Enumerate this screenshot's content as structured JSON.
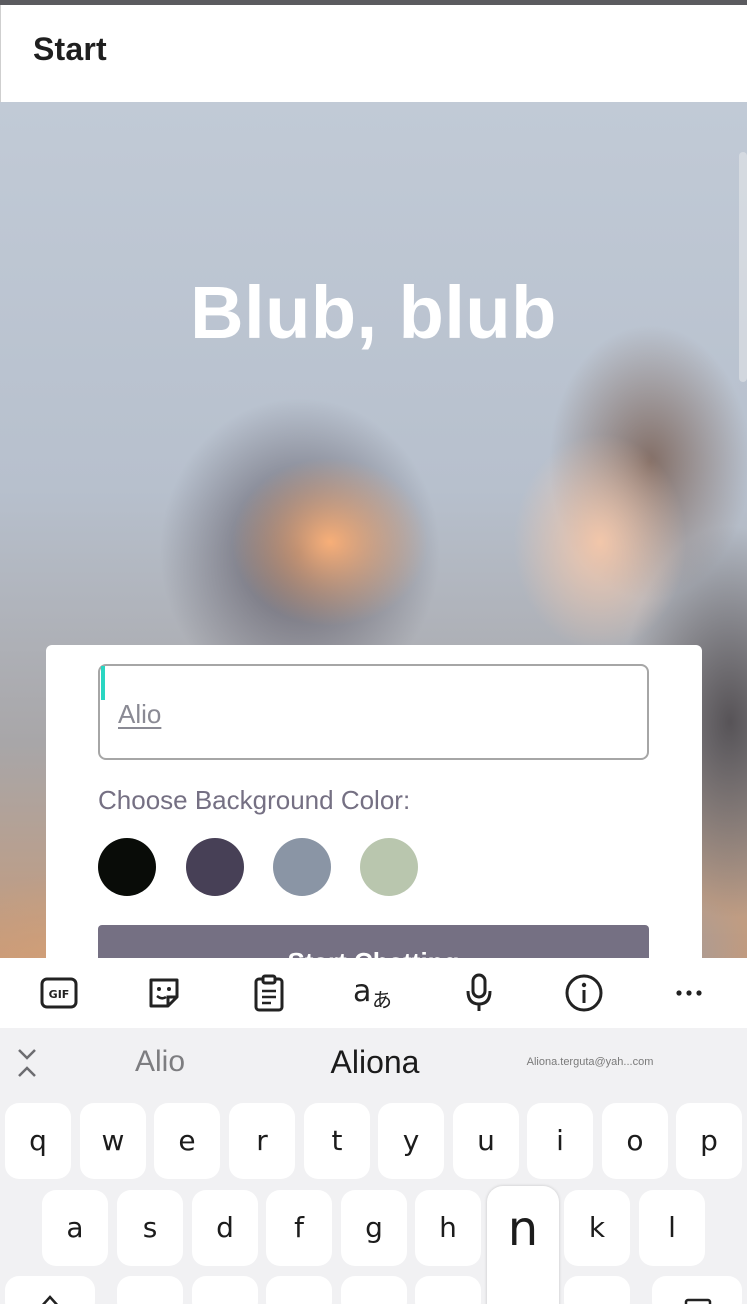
{
  "app_bar": {
    "title": "Start"
  },
  "hero": {
    "title": "Blub, blub"
  },
  "form": {
    "name_value": "Alio",
    "bg_label": "Choose Background Color:",
    "colors": [
      "#090C08",
      "#474056",
      "#8A95A5",
      "#B9C6AE"
    ],
    "button_label": "Start Chatting"
  },
  "keyboard": {
    "toolbar_icons": [
      "gif-icon",
      "sticker-icon",
      "clipboard-icon",
      "translate-icon",
      "microphone-icon",
      "info-icon",
      "more-icon"
    ],
    "suggestions": [
      "Alio",
      "Aliona",
      "Aliona.terguta@yah...com"
    ],
    "row1": [
      "q",
      "w",
      "e",
      "r",
      "t",
      "y",
      "u",
      "i",
      "o",
      "p"
    ],
    "row2": [
      "a",
      "s",
      "d",
      "f",
      "g",
      "h",
      "n",
      "k",
      "l"
    ]
  }
}
